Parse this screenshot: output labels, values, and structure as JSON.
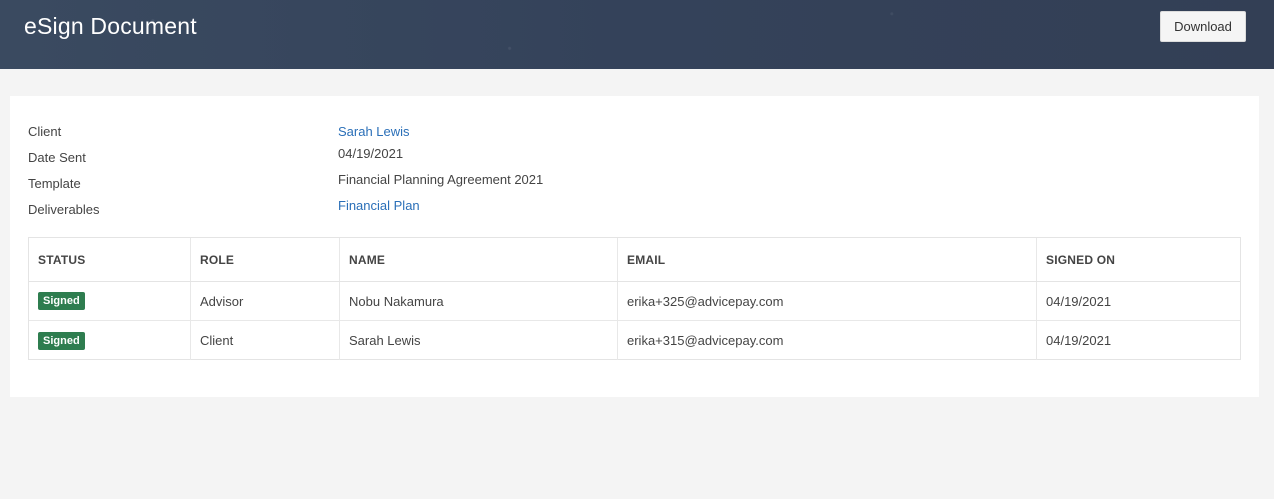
{
  "header": {
    "title": "eSign Document",
    "download_label": "Download"
  },
  "info": {
    "client_label": "Client",
    "client_value": "Sarah Lewis",
    "date_sent_label": "Date Sent",
    "date_sent_value": "04/19/2021",
    "template_label": "Template",
    "template_value": "Financial Planning Agreement 2021",
    "deliverables_label": "Deliverables",
    "deliverables_value": "Financial Plan"
  },
  "table": {
    "headers": [
      "STATUS",
      "ROLE",
      "NAME",
      "EMAIL",
      "SIGNED ON"
    ],
    "rows": [
      {
        "status": "Signed",
        "role": "Advisor",
        "name": "Nobu Nakamura",
        "email": "erika+325@advicepay.com",
        "signed_on": "04/19/2021"
      },
      {
        "status": "Signed",
        "role": "Client",
        "name": "Sarah Lewis",
        "email": "erika+315@advicepay.com",
        "signed_on": "04/19/2021"
      }
    ]
  },
  "colors": {
    "header_bg": "#37445a",
    "link": "#2a6fb8",
    "signed_badge": "#2e7d4f"
  }
}
